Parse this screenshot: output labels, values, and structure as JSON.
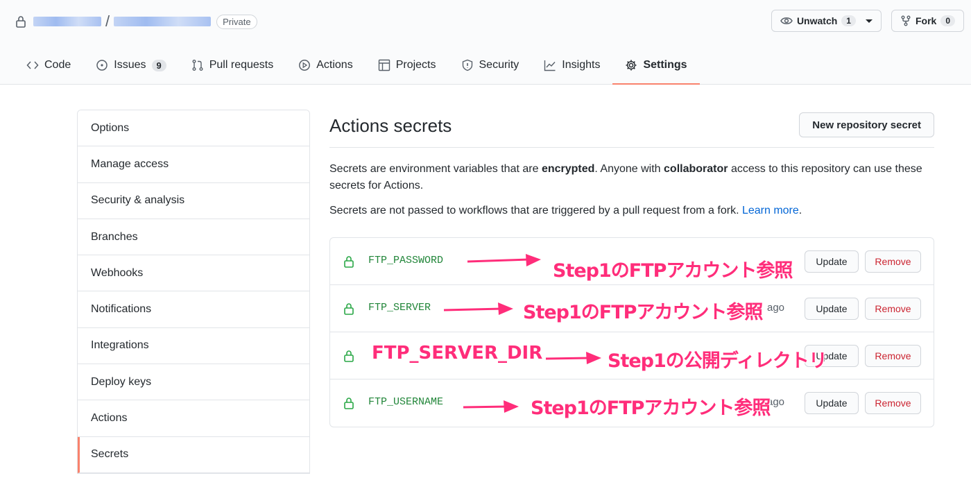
{
  "repo": {
    "visibility": "Private"
  },
  "header_actions": {
    "unwatch_label": "Unwatch",
    "unwatch_count": "1",
    "fork_label": "Fork",
    "fork_count": "0"
  },
  "tabs": [
    {
      "label": "Code",
      "icon": "code-icon"
    },
    {
      "label": "Issues",
      "icon": "issue-icon",
      "count": "9"
    },
    {
      "label": "Pull requests",
      "icon": "pull-request-icon"
    },
    {
      "label": "Actions",
      "icon": "play-icon"
    },
    {
      "label": "Projects",
      "icon": "project-icon"
    },
    {
      "label": "Security",
      "icon": "shield-icon"
    },
    {
      "label": "Insights",
      "icon": "graph-icon"
    },
    {
      "label": "Settings",
      "icon": "gear-icon",
      "selected": true
    }
  ],
  "sidebar": {
    "items": [
      {
        "label": "Options"
      },
      {
        "label": "Manage access"
      },
      {
        "label": "Security & analysis"
      },
      {
        "label": "Branches"
      },
      {
        "label": "Webhooks"
      },
      {
        "label": "Notifications"
      },
      {
        "label": "Integrations"
      },
      {
        "label": "Deploy keys"
      },
      {
        "label": "Actions"
      },
      {
        "label": "Secrets",
        "selected": true
      }
    ]
  },
  "main": {
    "title": "Actions secrets",
    "new_secret_label": "New repository secret",
    "desc1_a": "Secrets are environment variables that are ",
    "desc1_b": "encrypted",
    "desc1_c": ". Anyone with ",
    "desc1_d": "collaborator",
    "desc1_e": " access to this repository can use these secrets for Actions.",
    "desc2_a": "Secrets are not passed to workflows that are triggered by a pull request from a fork. ",
    "desc2_link": "Learn more",
    "desc2_end": "."
  },
  "secrets": [
    {
      "name": "FTP_PASSWORD",
      "updated": "",
      "update_label": "Update",
      "remove_label": "Remove"
    },
    {
      "name": "FTP_SERVER",
      "updated": "ago",
      "update_label": "Update",
      "remove_label": "Remove"
    },
    {
      "name": "",
      "updated": "",
      "update_label": "Update",
      "remove_label": "Remove"
    },
    {
      "name": "FTP_USERNAME",
      "updated": "ago",
      "update_label": "Update",
      "remove_label": "Remove"
    }
  ],
  "annotations": {
    "row1": "Step1のFTPアカウント参照",
    "row2": "Step1のFTPアカウント参照",
    "row3_name": "FTP_SERVER_DIR",
    "row3": "Step1の公開ディレクトリ",
    "row4": "Step1のFTPアカウント参照",
    "color": "#ff2d7a"
  }
}
